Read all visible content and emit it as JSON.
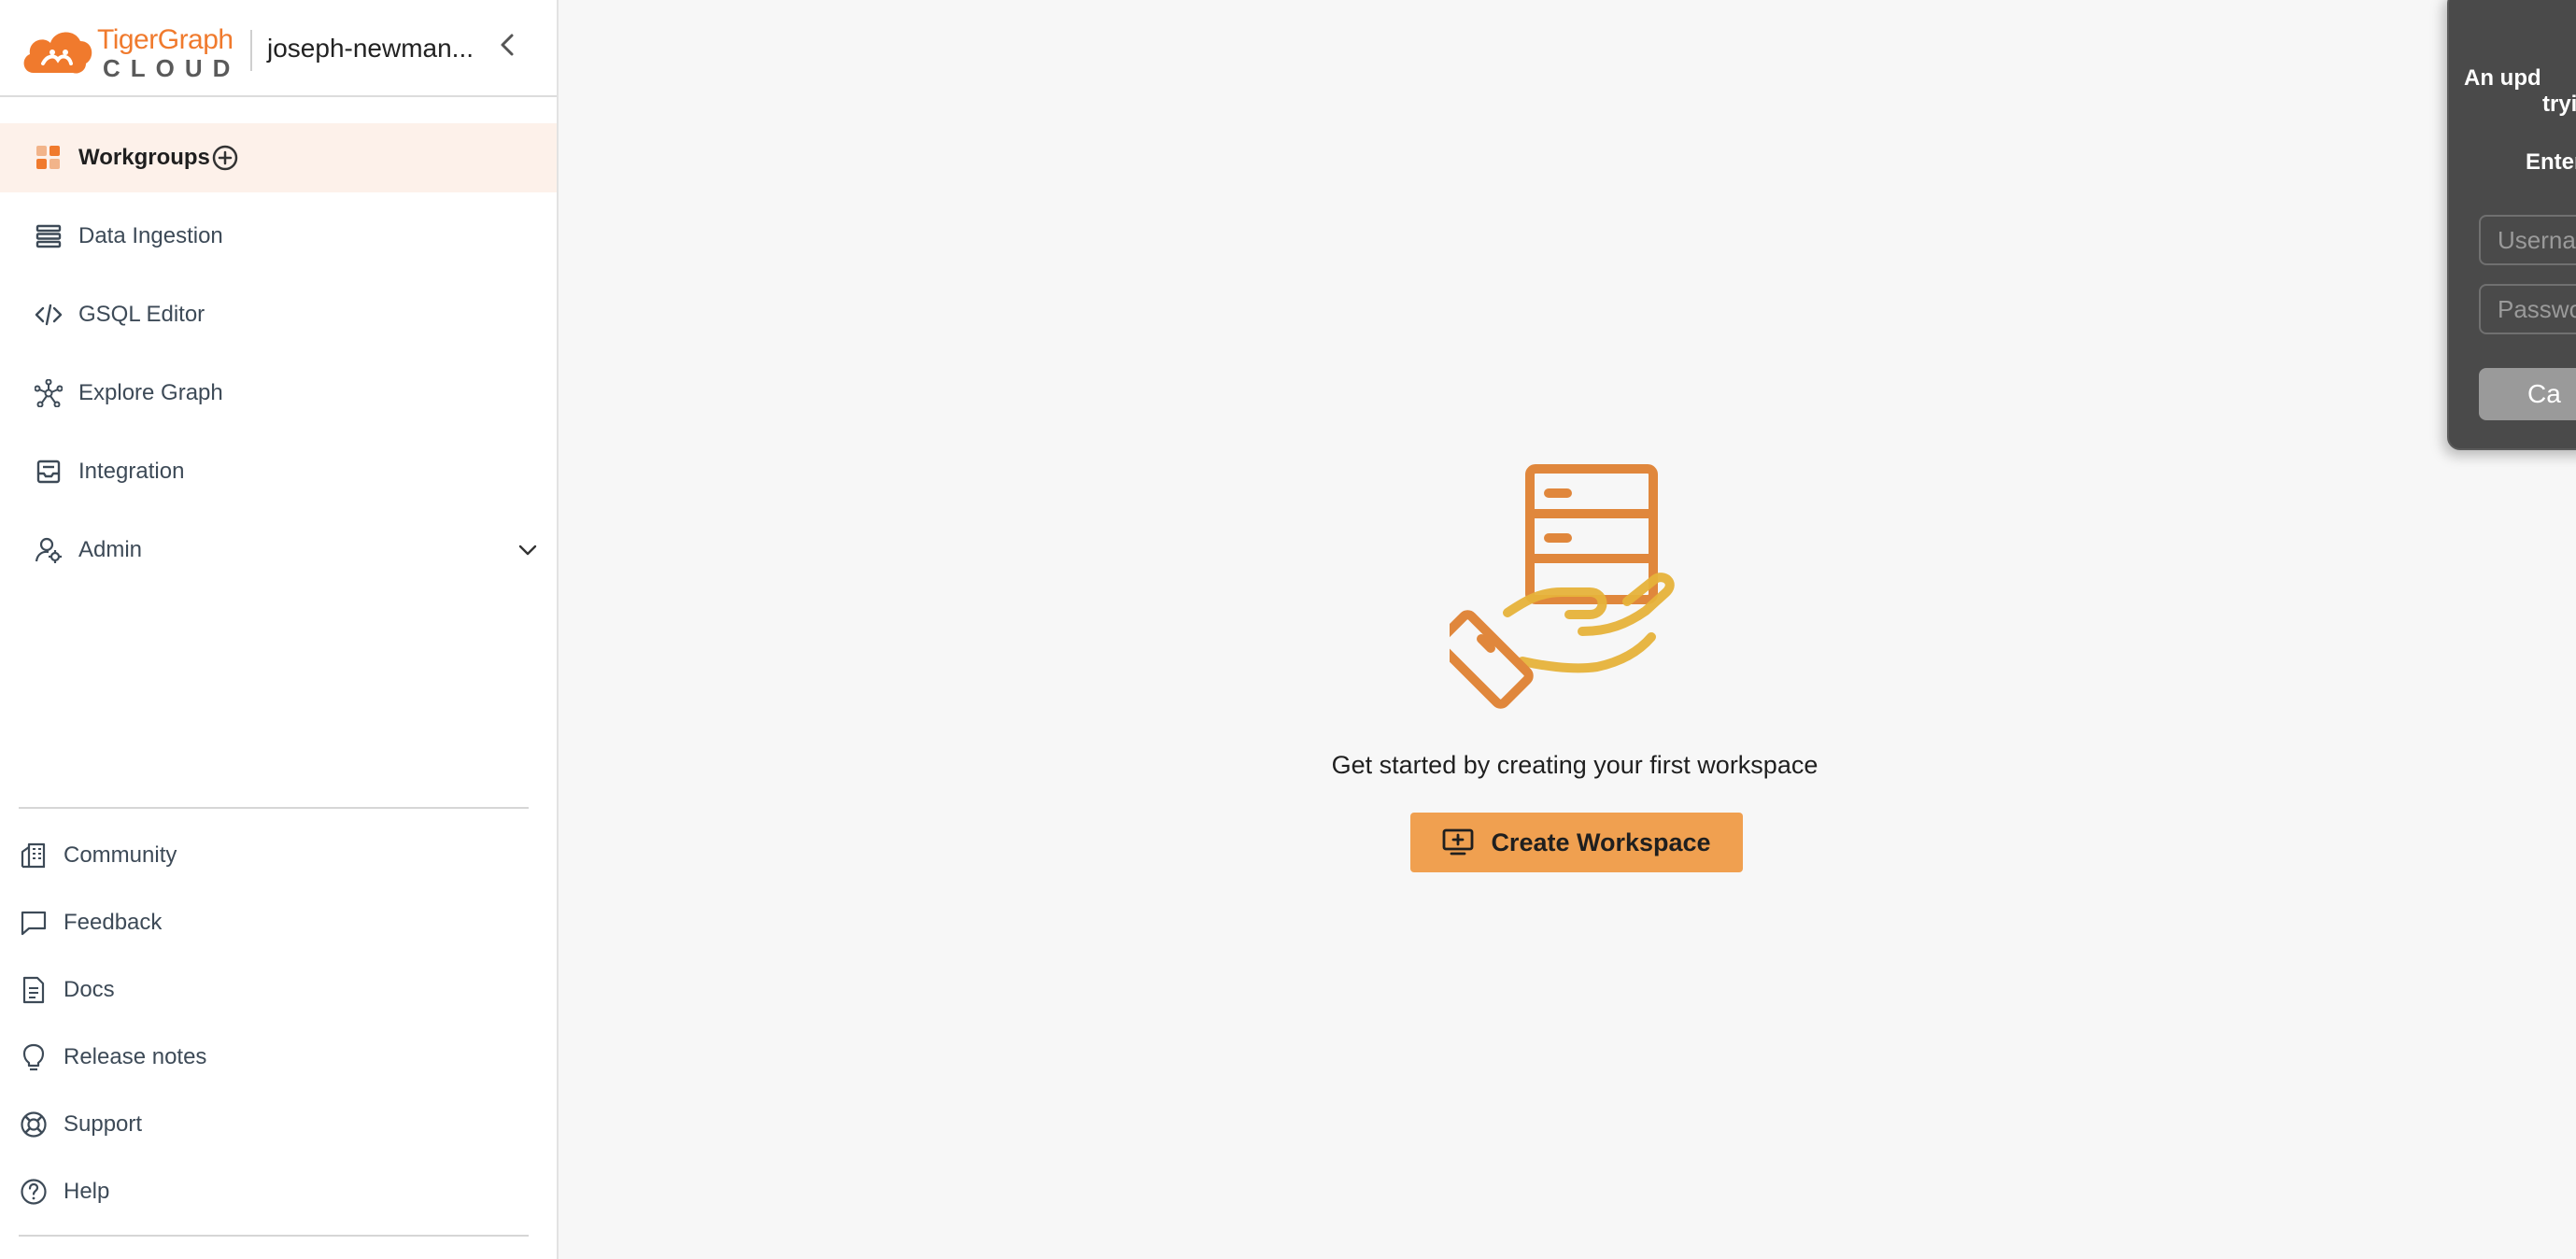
{
  "sidebar": {
    "brand": {
      "top": "TigerGraph",
      "bottom": "CLOUD"
    },
    "org_name": "joseph-newman...",
    "nav": [
      {
        "label": "Workgroups",
        "icon": "workgroups-icon",
        "active": true
      },
      {
        "label": "Data Ingestion",
        "icon": "data-ingestion-icon"
      },
      {
        "label": "GSQL Editor",
        "icon": "code-icon"
      },
      {
        "label": "Explore Graph",
        "icon": "graph-icon"
      },
      {
        "label": "Integration",
        "icon": "inbox-icon"
      },
      {
        "label": "Admin",
        "icon": "admin-icon"
      }
    ],
    "footer": [
      {
        "label": "Community",
        "icon": "community-icon"
      },
      {
        "label": "Feedback",
        "icon": "chat-icon"
      },
      {
        "label": "Docs",
        "icon": "document-icon"
      },
      {
        "label": "Release notes",
        "icon": "lightbulb-icon"
      },
      {
        "label": "Support",
        "icon": "lifebuoy-icon"
      },
      {
        "label": "Help",
        "icon": "help-icon"
      }
    ]
  },
  "main": {
    "empty_message": "Get started by creating your first workspace",
    "create_button_label": "Create Workspace"
  },
  "dialog": {
    "line1": "An upd",
    "line2": "tryin",
    "line3": "Enter",
    "username_placeholder": "Username",
    "password_placeholder": "Password",
    "button_label": "Ca"
  },
  "colors": {
    "accent": "#f0a050",
    "active_bg": "#fdf1ea",
    "brand_orange": "#f07a2d"
  }
}
